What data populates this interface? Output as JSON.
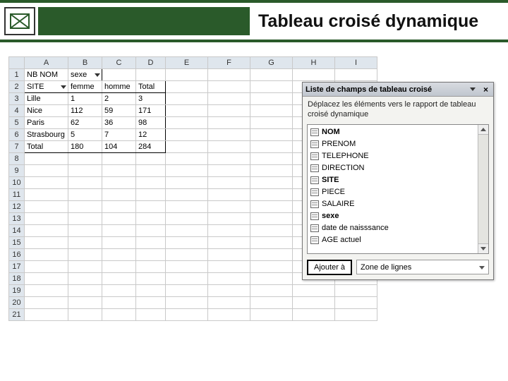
{
  "header": {
    "title": "Tableau croisé dynamique"
  },
  "columns": [
    "A",
    "B",
    "C",
    "D",
    "E",
    "F",
    "G",
    "H",
    "I"
  ],
  "rows_count": 21,
  "pivot": {
    "data_field": "NB NOM",
    "col_field": "sexe",
    "row_field": "SITE",
    "col_headers": {
      "c1": "femme",
      "c2": "homme",
      "c3": "Total"
    },
    "rows": [
      {
        "label": "Lille",
        "femme": "1",
        "homme": "2",
        "total": "3"
      },
      {
        "label": "Nice",
        "femme": "112",
        "homme": "59",
        "total": "171"
      },
      {
        "label": "Paris",
        "femme": "62",
        "homme": "36",
        "total": "98"
      },
      {
        "label": "Strasbourg",
        "femme": "5",
        "homme": "7",
        "total": "12"
      }
    ],
    "grand_total": {
      "label": "Total",
      "femme": "180",
      "homme": "104",
      "total": "284"
    }
  },
  "field_panel": {
    "title": "Liste de champs de tableau croisé",
    "instruction": "Déplacez les éléments vers le rapport de tableau croisé dynamique",
    "fields": [
      {
        "name": "NOM",
        "bold": true
      },
      {
        "name": "PRENOM",
        "bold": false
      },
      {
        "name": "TELEPHONE",
        "bold": false
      },
      {
        "name": "DIRECTION",
        "bold": false
      },
      {
        "name": "SITE",
        "bold": true
      },
      {
        "name": "PIECE",
        "bold": false
      },
      {
        "name": "SALAIRE",
        "bold": false
      },
      {
        "name": "sexe",
        "bold": true
      },
      {
        "name": "date de naisssance",
        "bold": false
      },
      {
        "name": "AGE actuel",
        "bold": false
      }
    ],
    "add_button": "Ajouter à",
    "drop_target": "Zone de lignes"
  }
}
